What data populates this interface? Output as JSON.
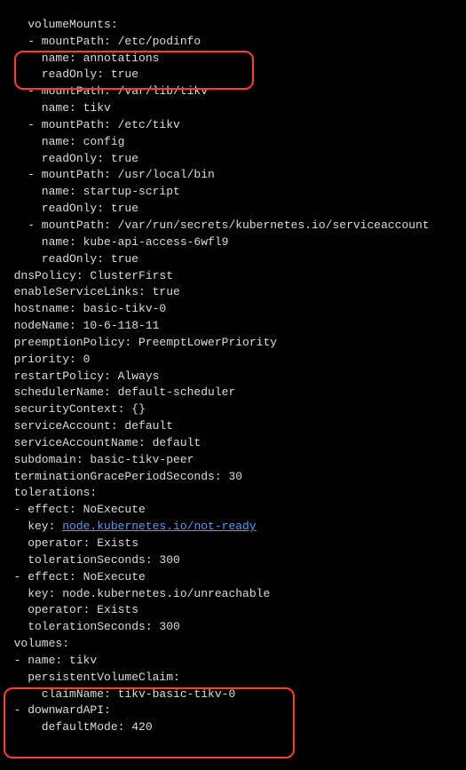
{
  "yaml": {
    "l01": "    volumeMounts:",
    "l02": "    - mountPath: /etc/podinfo",
    "l03": "      name: annotations",
    "l04": "      readOnly: true",
    "l05": "    - mountPath: /var/lib/tikv",
    "l06": "      name: tikv",
    "l07": "    - mountPath: /etc/tikv",
    "l08": "      name: config",
    "l09": "      readOnly: true",
    "l10": "    - mountPath: /usr/local/bin",
    "l11": "      name: startup-script",
    "l12": "      readOnly: true",
    "l13": "    - mountPath: /var/run/secrets/kubernetes.io/serviceaccount",
    "l14": "      name: kube-api-access-6wfl9",
    "l15": "      readOnly: true",
    "l16": "  dnsPolicy: ClusterFirst",
    "l17": "  enableServiceLinks: true",
    "l18": "  hostname: basic-tikv-0",
    "l19": "  nodeName: 10-6-118-11",
    "l20": "  preemptionPolicy: PreemptLowerPriority",
    "l21": "  priority: 0",
    "l22": "  restartPolicy: Always",
    "l23": "  schedulerName: default-scheduler",
    "l24": "  securityContext: {}",
    "l25": "  serviceAccount: default",
    "l26": "  serviceAccountName: default",
    "l27": "  subdomain: basic-tikv-peer",
    "l28": "  terminationGracePeriodSeconds: 30",
    "l29": "  tolerations:",
    "l30": "  - effect: NoExecute",
    "l31a": "    key: ",
    "l31b": "node.kubernetes.io/not-ready",
    "l32": "    operator: Exists",
    "l33": "    tolerationSeconds: 300",
    "l34": "  - effect: NoExecute",
    "l35": "    key: node.kubernetes.io/unreachable",
    "l36": "    operator: Exists",
    "l37": "    tolerationSeconds: 300",
    "l38": "  volumes:",
    "l39": "  - name: tikv",
    "l40": "    persistentVolumeClaim:",
    "l41": "      claimName: tikv-basic-tikv-0",
    "l42": "  - downwardAPI:",
    "l43": "      defaultMode: 420"
  }
}
